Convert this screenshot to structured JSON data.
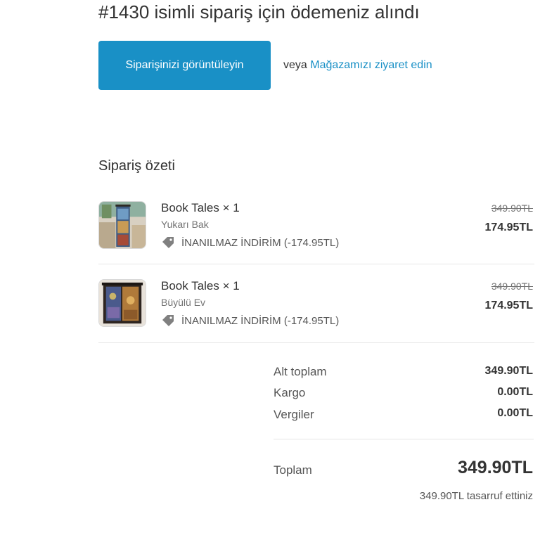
{
  "header": {
    "title": "#1430 isimli sipariş için ödemeniz alındı",
    "view_order_label": "Siparişinizi görüntüleyin",
    "or_label": "veya",
    "visit_store_label": "Mağazamızı ziyaret edin"
  },
  "summary": {
    "title": "Sipariş özeti",
    "items": [
      {
        "name": "Book Tales × 1",
        "variant": "Yukarı Bak",
        "discount": "İNANILMAZ İNDİRİM (-174.95TL)",
        "old_price": "349.90TL",
        "price": "174.95TL"
      },
      {
        "name": "Book Tales × 1",
        "variant": "Büyülü Ev",
        "discount": "İNANILMAZ İNDİRİM (-174.95TL)",
        "old_price": "349.90TL",
        "price": "174.95TL"
      }
    ],
    "subtotal_label": "Alt toplam",
    "subtotal_value": "349.90TL",
    "shipping_label": "Kargo",
    "shipping_value": "0.00TL",
    "taxes_label": "Vergiler",
    "taxes_value": "0.00TL",
    "total_label": "Toplam",
    "total_value": "349.90TL",
    "savings_text": "349.90TL tasarruf ettiniz"
  },
  "colors": {
    "accent": "#1990c6",
    "text": "#333333",
    "muted": "#737373"
  },
  "icons": {
    "discount": "tag-icon"
  }
}
